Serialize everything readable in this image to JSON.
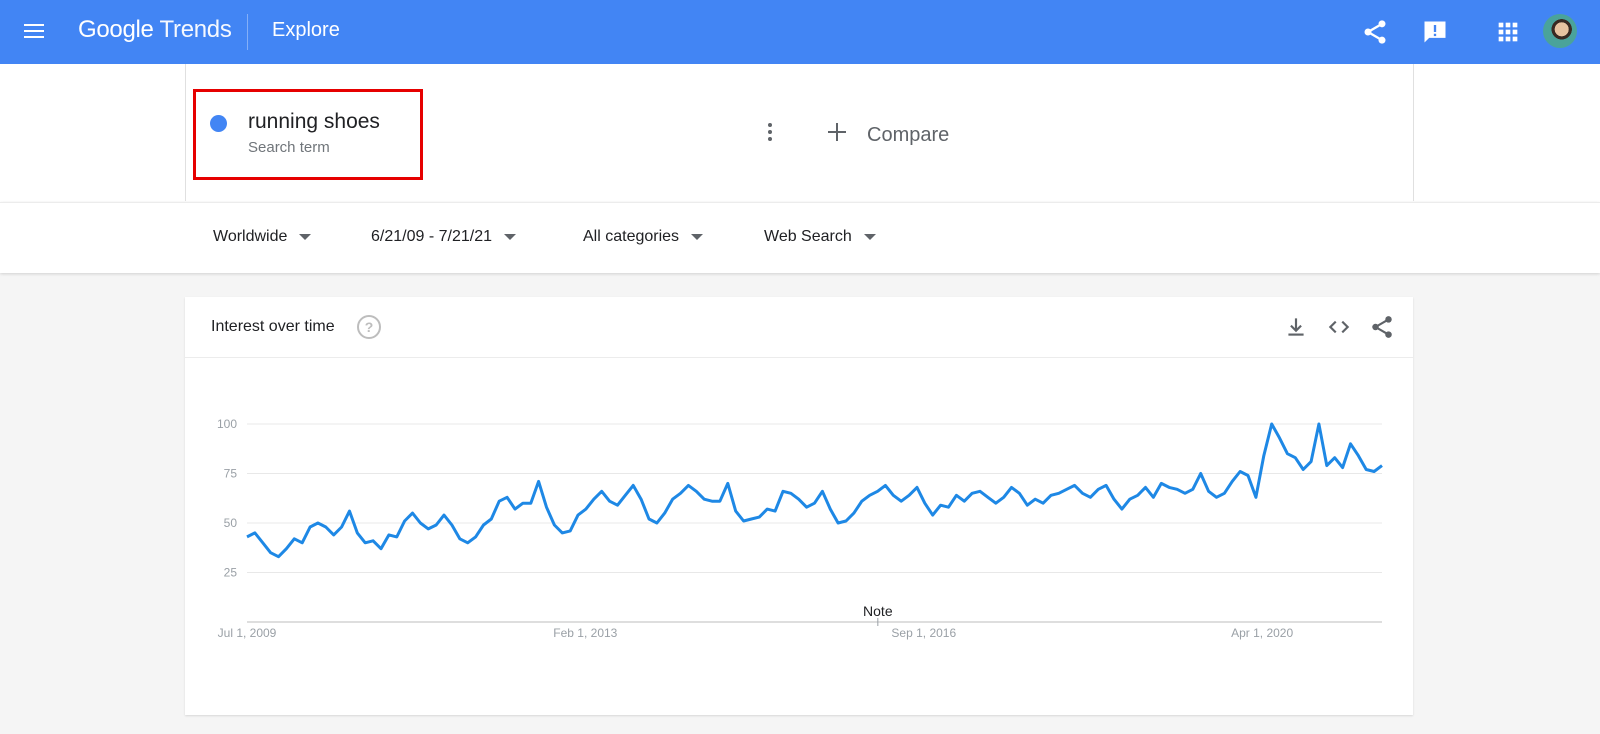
{
  "app": {
    "brand_google": "Google",
    "brand_trends": "Trends",
    "page_title": "Explore"
  },
  "header_icons": [
    "menu-icon",
    "share-icon",
    "feedback-icon",
    "apps-icon",
    "avatar"
  ],
  "search": {
    "term": "running shoes",
    "term_type": "Search term",
    "term_color": "#4285f4",
    "compare_label": "Compare"
  },
  "filters": {
    "region": "Worldwide",
    "date_range": "6/21/09 - 7/21/21",
    "category": "All categories",
    "search_type": "Web Search"
  },
  "colors": {
    "header": "#4285f4",
    "line": "#1e88e5",
    "highlight": "#e60000"
  },
  "card": {
    "title": "Interest over time",
    "icons": [
      "download-icon",
      "embed-icon",
      "share-icon"
    ]
  },
  "chart_data": {
    "type": "line",
    "title": "Interest over time",
    "x_start": "Jul 1, 2009",
    "x_end": "Jul 2021",
    "x_tick_labels": [
      "Jul 1, 2009",
      "Feb 1, 2013",
      "Sep 1, 2016",
      "Apr 1, 2020"
    ],
    "y_ticks": [
      25,
      50,
      75,
      100
    ],
    "ylim": [
      0,
      100
    ],
    "grid": true,
    "note_label": "Note",
    "series": [
      {
        "name": "running shoes",
        "values": [
          43,
          45,
          40,
          35,
          33,
          37,
          42,
          40,
          48,
          50,
          48,
          44,
          48,
          56,
          45,
          40,
          41,
          37,
          44,
          43,
          51,
          55,
          50,
          47,
          49,
          54,
          49,
          42,
          40,
          43,
          49,
          52,
          61,
          63,
          57,
          60,
          60,
          71,
          58,
          49,
          45,
          46,
          54,
          57,
          62,
          66,
          61,
          59,
          64,
          69,
          62,
          52,
          50,
          55,
          62,
          65,
          69,
          66,
          62,
          61,
          61,
          70,
          56,
          51,
          52,
          53,
          57,
          56,
          66,
          65,
          62,
          58,
          60,
          66,
          57,
          50,
          51,
          55,
          61,
          64,
          66,
          69,
          64,
          61,
          64,
          68,
          60,
          54,
          59,
          58,
          64,
          61,
          65,
          66,
          63,
          60,
          63,
          68,
          65,
          59,
          62,
          60,
          64,
          65,
          67,
          69,
          65,
          63,
          67,
          69,
          62,
          57,
          62,
          64,
          68,
          63,
          70,
          68,
          67,
          65,
          67,
          75,
          66,
          63,
          65,
          71,
          76,
          74,
          63,
          84,
          100,
          93,
          85,
          83,
          77,
          81,
          100,
          79,
          83,
          78,
          90,
          84,
          77,
          76,
          79
        ]
      }
    ]
  }
}
